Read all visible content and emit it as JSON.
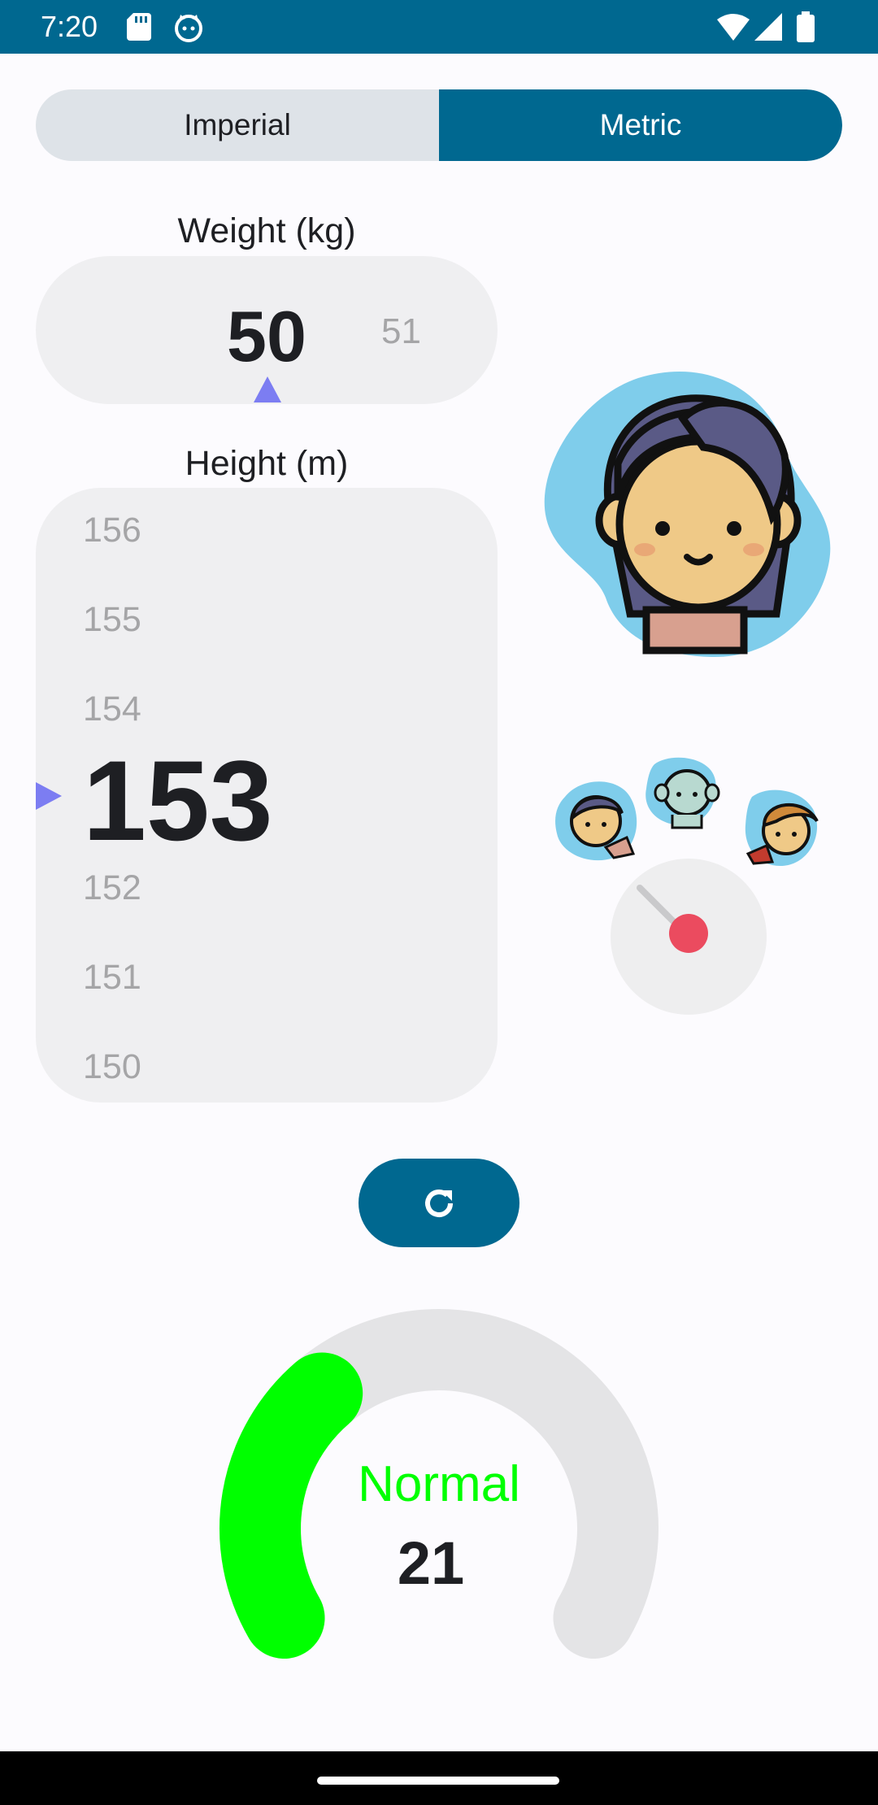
{
  "status_bar": {
    "time": "7:20",
    "icons": [
      "sd-card-icon",
      "cat-face-icon",
      "wifi-icon",
      "signal-icon",
      "battery-icon"
    ]
  },
  "units": {
    "imperial_label": "Imperial",
    "metric_label": "Metric",
    "selected": "Metric"
  },
  "weight": {
    "label": "Weight (kg)",
    "current": "50",
    "next": "51"
  },
  "height": {
    "label": "Height (m)",
    "above": [
      "156",
      "155",
      "154"
    ],
    "current": "153",
    "below": [
      "152",
      "151",
      "150"
    ]
  },
  "result": {
    "status": "Normal",
    "bmi": "21",
    "gauge_fraction": 0.33
  },
  "colors": {
    "primary": "#006890",
    "pointer": "#7C7DF2",
    "normal": "#00FF00",
    "track": "#E4E4E6",
    "needle_dot": "#EB4B5F"
  }
}
